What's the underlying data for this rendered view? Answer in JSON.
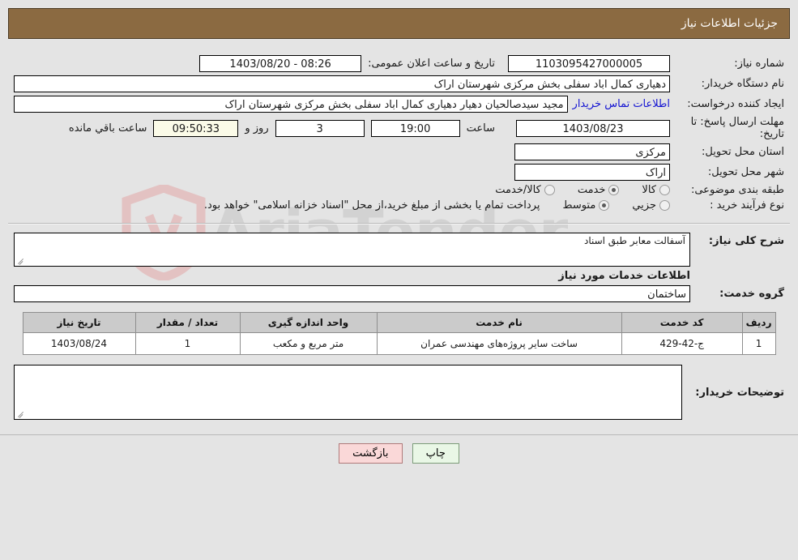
{
  "header": {
    "title": "جزئیات اطلاعات نیاز",
    "bar_color": "#8b6a41"
  },
  "watermark": {
    "text": "AriaTender"
  },
  "form": {
    "need_number_label": "شماره نیاز:",
    "need_number_value": "1103095427000005",
    "public_announce_label": "تاریخ و ساعت اعلان عمومی:",
    "public_announce_value": "1403/08/20 - 08:26",
    "buyer_org_label": "نام دستگاه خریدار:",
    "buyer_org_value": "دهیاری کمال اباد سفلی بخش مرکزی  شهرستان اراک",
    "creator_label": "ایجاد کننده درخواست:",
    "creator_value": "مجید سیدصالحیان دهیار دهیاری کمال اباد سفلی بخش مرکزی  شهرستان اراک",
    "contact_link": "اطلاعات تماس خریدار",
    "deadline_label": "مهلت ارسال پاسخ: تا تاریخ:",
    "deadline_date": "1403/08/23",
    "hour_label": "ساعت",
    "hour_value": "19:00",
    "days_value": "3",
    "days_word": "روز و",
    "remaining_value": "09:50:33",
    "remaining_word": "ساعت باقي مانده",
    "province_label": "استان محل تحویل:",
    "province_value": "مرکزی",
    "city_label": "شهر محل تحویل:",
    "city_value": "اراک",
    "category_label": "طبقه بندی موضوعی:",
    "category_options": [
      {
        "label": "کالا",
        "selected": false
      },
      {
        "label": "خدمت",
        "selected": true
      },
      {
        "label": "کالا/خدمت",
        "selected": false
      }
    ],
    "process_label": "نوع فرآیند خرید :",
    "process_options": [
      {
        "label": "جزیي",
        "selected": false
      },
      {
        "label": "متوسط",
        "selected": true
      }
    ],
    "process_note": "پرداخت تمام یا بخشی از مبلغ خرید،از محل \"اسناد خزانه اسلامی\" خواهد بود."
  },
  "description": {
    "general_label": "شرح کلی نیاز:",
    "general_value": "آسفالت معابر طبق اسناد",
    "services_heading": "اطلاعات خدمات مورد نیاز",
    "service_group_label": "گروه خدمت:",
    "service_group_value": "ساختمان"
  },
  "grid": {
    "columns": [
      "ردیف",
      "کد خدمت",
      "نام خدمت",
      "واحد اندازه گیری",
      "تعداد / مقدار",
      "تاریخ نیاز"
    ],
    "rows": [
      {
        "row": "1",
        "code": "ج-42-429",
        "name": "ساخت سایر پروژه‌های مهندسی عمران",
        "unit": "متر مربع و مکعب",
        "quantity": "1",
        "need_date": "1403/08/24"
      }
    ]
  },
  "buyer_notes": {
    "label": "توضیحات خریدار:",
    "value": ""
  },
  "footer": {
    "print_label": "چاپ",
    "back_label": "بازگشت"
  }
}
